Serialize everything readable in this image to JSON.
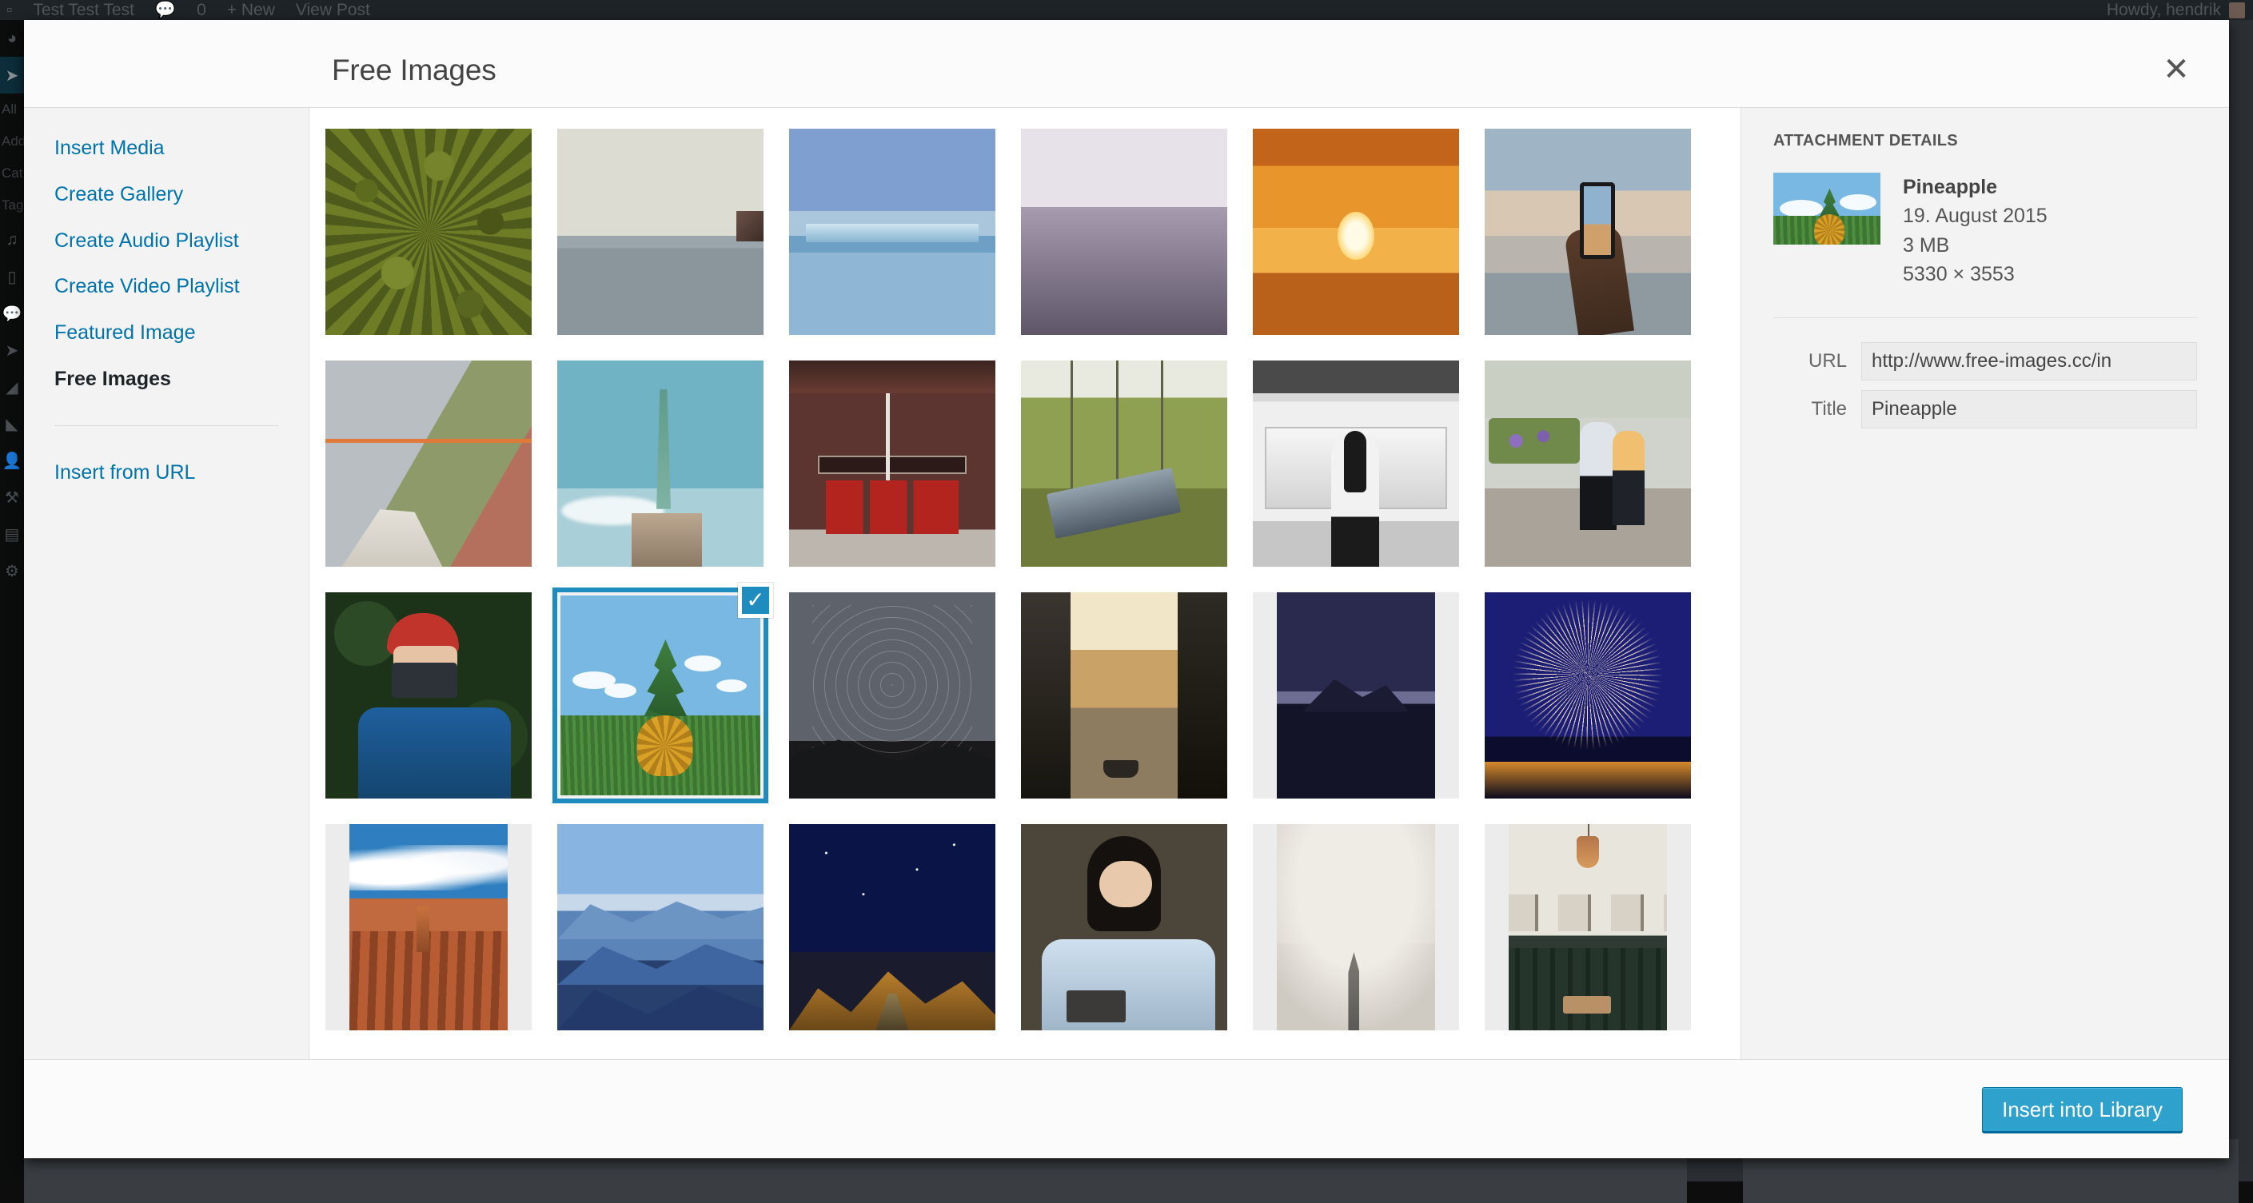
{
  "admin_bar": {
    "site_name": "Test Test Test",
    "comment_icon": "comment-icon",
    "comment_count": "0",
    "new_label": "+ New",
    "view_post_label": "View Post",
    "howdy": "Howdy, hendrik",
    "avatar": "user-avatar"
  },
  "wp_sidebar": {
    "items": [
      {
        "icon": "appearance-palette-icon",
        "label": ""
      },
      {
        "icon": "pin-posts-icon",
        "label": ""
      },
      {
        "icon": "sub-all-posts",
        "label": "All"
      },
      {
        "icon": "sub-add-new",
        "label": "Add"
      },
      {
        "icon": "sub-categories",
        "label": "Cat"
      },
      {
        "icon": "sub-tags",
        "label": "Tag"
      },
      {
        "icon": "media-icon",
        "label": ""
      },
      {
        "icon": "pages-icon",
        "label": ""
      },
      {
        "icon": "comments-icon",
        "label": ""
      },
      {
        "icon": "pin-icon",
        "label": ""
      },
      {
        "icon": "plugins-icon",
        "label": ""
      },
      {
        "icon": "appearance-icon",
        "label": ""
      },
      {
        "icon": "users-icon",
        "label": ""
      },
      {
        "icon": "tools-wrench-icon",
        "label": ""
      },
      {
        "icon": "seo-icon",
        "label": ""
      },
      {
        "icon": "settings-gear-icon",
        "label": ""
      }
    ]
  },
  "modal": {
    "title": "Free Images",
    "close_icon": "close-x-icon",
    "menu": [
      {
        "label": "Insert Media",
        "active": false
      },
      {
        "label": "Create Gallery",
        "active": false
      },
      {
        "label": "Create Audio Playlist",
        "active": false
      },
      {
        "label": "Create Video Playlist",
        "active": false
      },
      {
        "label": "Featured Image",
        "active": false
      },
      {
        "label": "Free Images",
        "active": true
      }
    ],
    "menu_secondary": [
      {
        "label": "Insert from URL",
        "active": false
      }
    ],
    "footer": {
      "primary_button": "Insert into Library"
    }
  },
  "attachments": [
    {
      "name": "aerial-forest-canopy",
      "art": "a-forest",
      "selected": false,
      "letterbox": false
    },
    {
      "name": "misty-lake-horizon",
      "art": "a-lake",
      "selected": false,
      "letterbox": false
    },
    {
      "name": "iceberg-blue-water",
      "art": "a-ice",
      "selected": false,
      "letterbox": false
    },
    {
      "name": "mountain-peaks-dusk",
      "art": "a-mtn",
      "selected": false,
      "letterbox": false
    },
    {
      "name": "sunset-heart-hands",
      "art": "a-sunset",
      "selected": false,
      "letterbox": false
    },
    {
      "name": "phone-photo-beach",
      "art": "a-phone",
      "selected": false,
      "letterbox": false
    },
    {
      "name": "rooftop-legs-city",
      "art": "a-rooftop",
      "selected": false,
      "letterbox": false
    },
    {
      "name": "statue-of-liberty",
      "art": "a-liberty",
      "selected": false,
      "letterbox": false
    },
    {
      "name": "massey-hall-facade",
      "art": "a-massey",
      "selected": false,
      "letterbox": false
    },
    {
      "name": "empty-playground-swings",
      "art": "a-swing",
      "selected": false,
      "letterbox": false
    },
    {
      "name": "woman-waiting-train",
      "art": "a-train",
      "selected": false,
      "letterbox": false
    },
    {
      "name": "couple-on-street",
      "art": "a-couple",
      "selected": false,
      "letterbox": false
    },
    {
      "name": "photographer-red-beanie",
      "art": "a-photog",
      "selected": false,
      "letterbox": false
    },
    {
      "name": "pineapple-in-grass",
      "art": "a-pine",
      "selected": true,
      "letterbox": false
    },
    {
      "name": "star-trails-night-sky",
      "art": "a-stars",
      "selected": false,
      "letterbox": false
    },
    {
      "name": "canal-boat-alley",
      "art": "a-canal",
      "selected": false,
      "letterbox": false
    },
    {
      "name": "night-mountain-lake",
      "art": "a-nightlake",
      "selected": false,
      "letterbox": true
    },
    {
      "name": "fireworks-over-city",
      "art": "a-fire",
      "selected": false,
      "letterbox": false
    },
    {
      "name": "bryce-canyon-hoodoos",
      "art": "a-bryce",
      "selected": false,
      "letterbox": true
    },
    {
      "name": "blue-layered-mountains",
      "art": "a-bluemtn",
      "selected": false,
      "letterbox": false
    },
    {
      "name": "night-desert-road",
      "art": "a-nightdesert",
      "selected": false,
      "letterbox": false
    },
    {
      "name": "woman-reading-book",
      "art": "a-reading",
      "selected": false,
      "letterbox": false
    },
    {
      "name": "foggy-church-spire",
      "art": "a-spire",
      "selected": false,
      "letterbox": true
    },
    {
      "name": "cafe-interior-lamp",
      "art": "a-cafe",
      "selected": false,
      "letterbox": true
    }
  ],
  "details": {
    "heading": "ATTACHMENT DETAILS",
    "thumbnail": "pineapple-thumbnail",
    "filename": "Pineapple",
    "date": "19. August 2015",
    "filesize": "3 MB",
    "dimensions": "5330 × 3553",
    "fields": [
      {
        "label": "URL",
        "value": "http://www.free-images.cc/in",
        "name": "url-field"
      },
      {
        "label": "Title",
        "value": "Pineapple",
        "name": "title-field"
      }
    ]
  },
  "colors": {
    "accent": "#0073aa",
    "selection": "#1e8cbe",
    "button": "#2ea2cc",
    "admin_dark": "#1d2327",
    "panel": "#f3f3f3"
  }
}
